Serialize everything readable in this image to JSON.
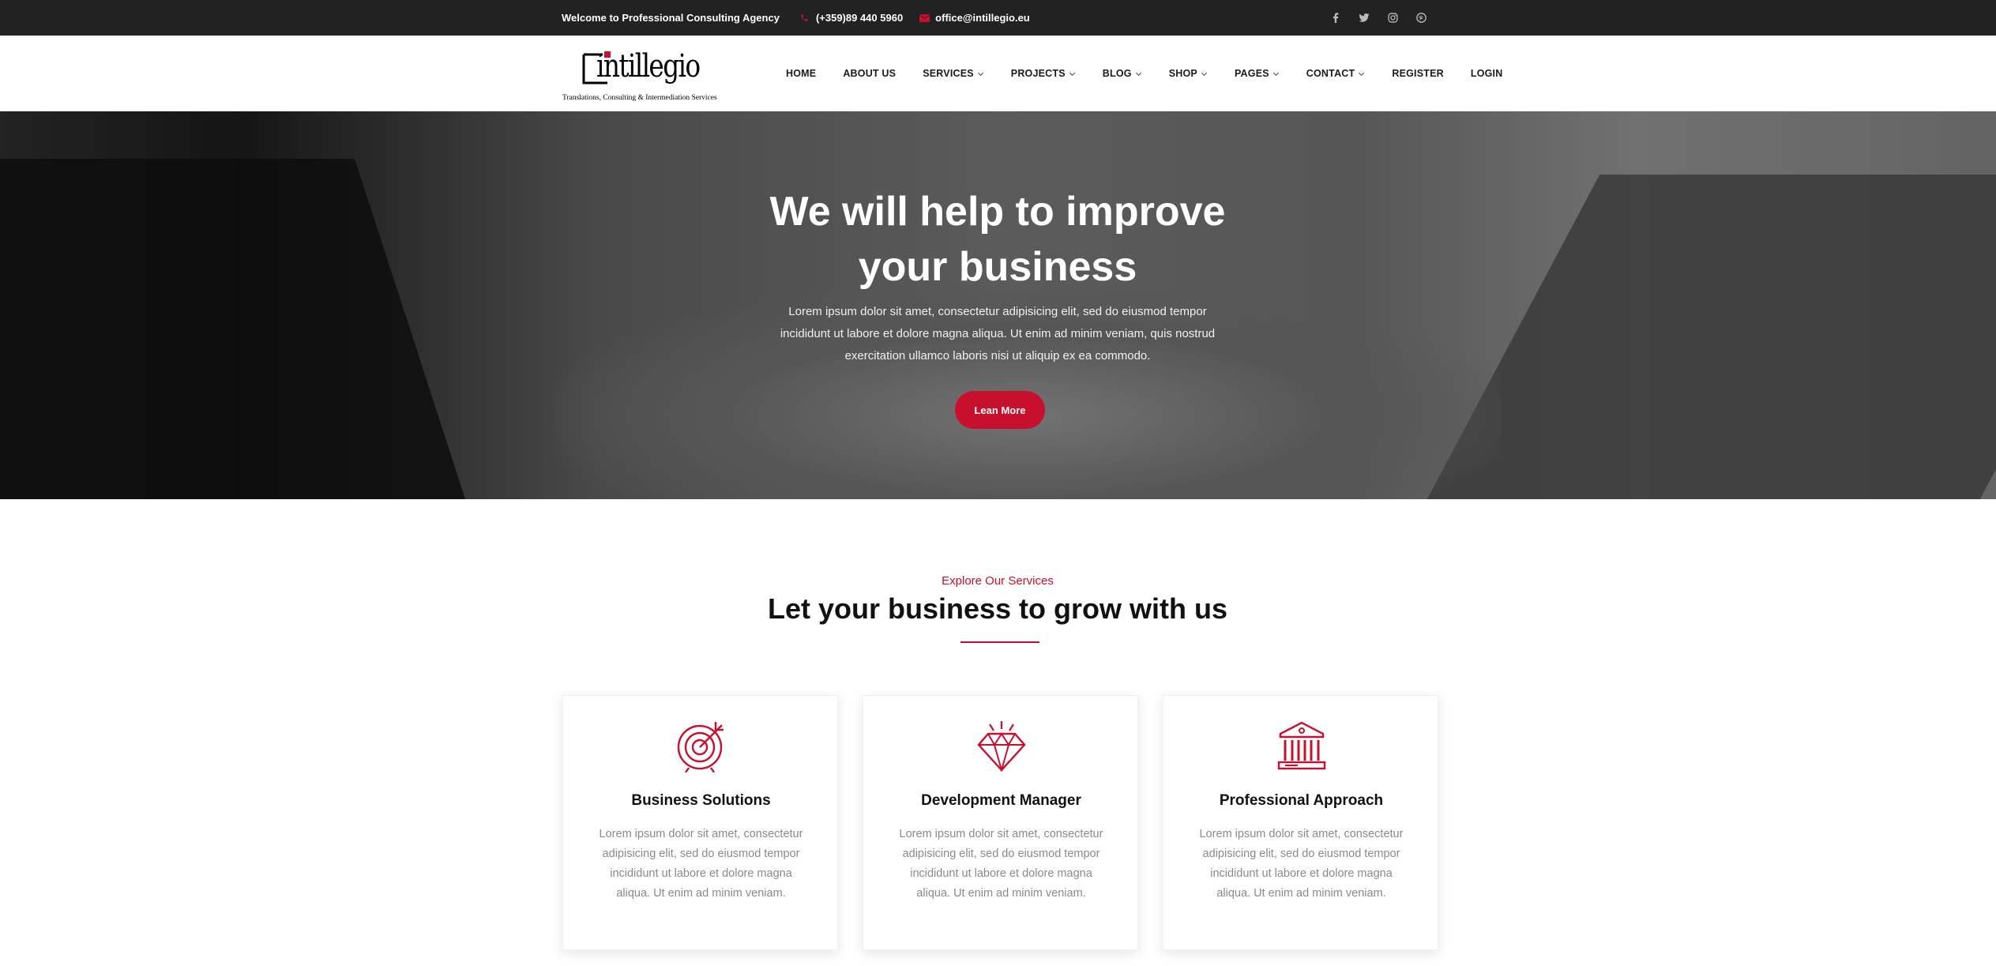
{
  "topbar": {
    "welcome": "Welcome to Professional Consulting Agency",
    "phone": "(+359)89 440 5960",
    "email": "office@intillegio.eu",
    "socials": [
      "facebook-icon",
      "twitter-icon",
      "instagram-icon",
      "pinterest-icon"
    ]
  },
  "logo": {
    "wordmark": "intillegio",
    "tagline": "Translations, Consulting & Intermediation Services"
  },
  "nav": {
    "items": [
      {
        "label": "HOME",
        "dropdown": false
      },
      {
        "label": "ABOUT US",
        "dropdown": false
      },
      {
        "label": "SERVICES",
        "dropdown": true
      },
      {
        "label": "PROJECTS",
        "dropdown": true
      },
      {
        "label": "BLOG",
        "dropdown": true
      },
      {
        "label": "SHOP",
        "dropdown": true
      },
      {
        "label": "PAGES",
        "dropdown": true
      },
      {
        "label": "CONTACT",
        "dropdown": true
      },
      {
        "label": "REGISTER",
        "dropdown": false
      },
      {
        "label": "LOGIN",
        "dropdown": false
      }
    ]
  },
  "hero": {
    "title_line1": "We will help to improve",
    "title_line2": "your business",
    "text": "Lorem ipsum dolor sit amet, consectetur adipisicing elit, sed do eiusmod tempor incididunt ut labore et dolore magna aliqua. Ut enim ad minim veniam, quis nostrud exercitation ullamco laboris nisi ut aliquip ex ea commodo.",
    "button": "Lean More"
  },
  "services": {
    "eyebrow": "Explore Our Services",
    "title": "Let your business to grow with us",
    "cards": [
      {
        "icon": "target-icon",
        "title": "Business Solutions",
        "text": "Lorem ipsum dolor sit amet, consectetur adipisicing elit, sed do eiusmod tempor incididunt ut labore et dolore magna aliqua. Ut enim ad minim veniam."
      },
      {
        "icon": "diamond-icon",
        "title": "Development Manager",
        "text": "Lorem ipsum dolor sit amet, consectetur adipisicing elit, sed do eiusmod tempor incididunt ut labore et dolore magna aliqua. Ut enim ad minim veniam."
      },
      {
        "icon": "bank-icon",
        "title": "Professional Approach",
        "text": "Lorem ipsum dolor sit amet, consectetur adipisicing elit, sed do eiusmod tempor incididunt ut labore et dolore magna aliqua. Ut enim ad minim veniam."
      }
    ]
  },
  "colors": {
    "accent": "#c8102e",
    "topbar_bg": "#222222",
    "text_dark": "#111111",
    "text_muted": "#8a8a8a"
  }
}
